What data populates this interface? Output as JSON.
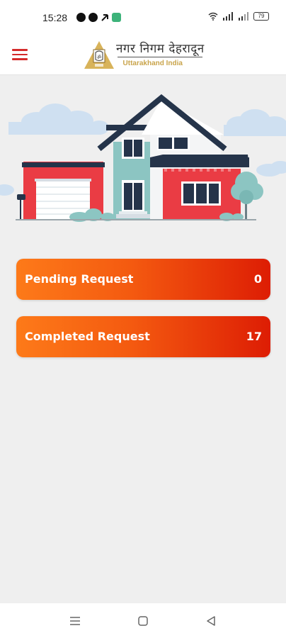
{
  "status_bar": {
    "time": "15:28",
    "battery": "79"
  },
  "header": {
    "logo_title": "नगर निगम देहरादून",
    "logo_subtitle": "Uttarakhand India",
    "menu_icon": "hamburger-icon"
  },
  "hero": {
    "illustration": "house-illustration"
  },
  "cards": [
    {
      "label": "Pending Request",
      "count": "0"
    },
    {
      "label": "Completed Request",
      "count": "17"
    }
  ],
  "colors": {
    "accent": "#d42b2b",
    "card_gradient_start": "#fd7a19",
    "card_gradient_end": "#dd1d04",
    "background": "#efefef"
  },
  "nav": {
    "items": [
      "recent-apps-icon",
      "home-icon",
      "back-icon"
    ]
  }
}
